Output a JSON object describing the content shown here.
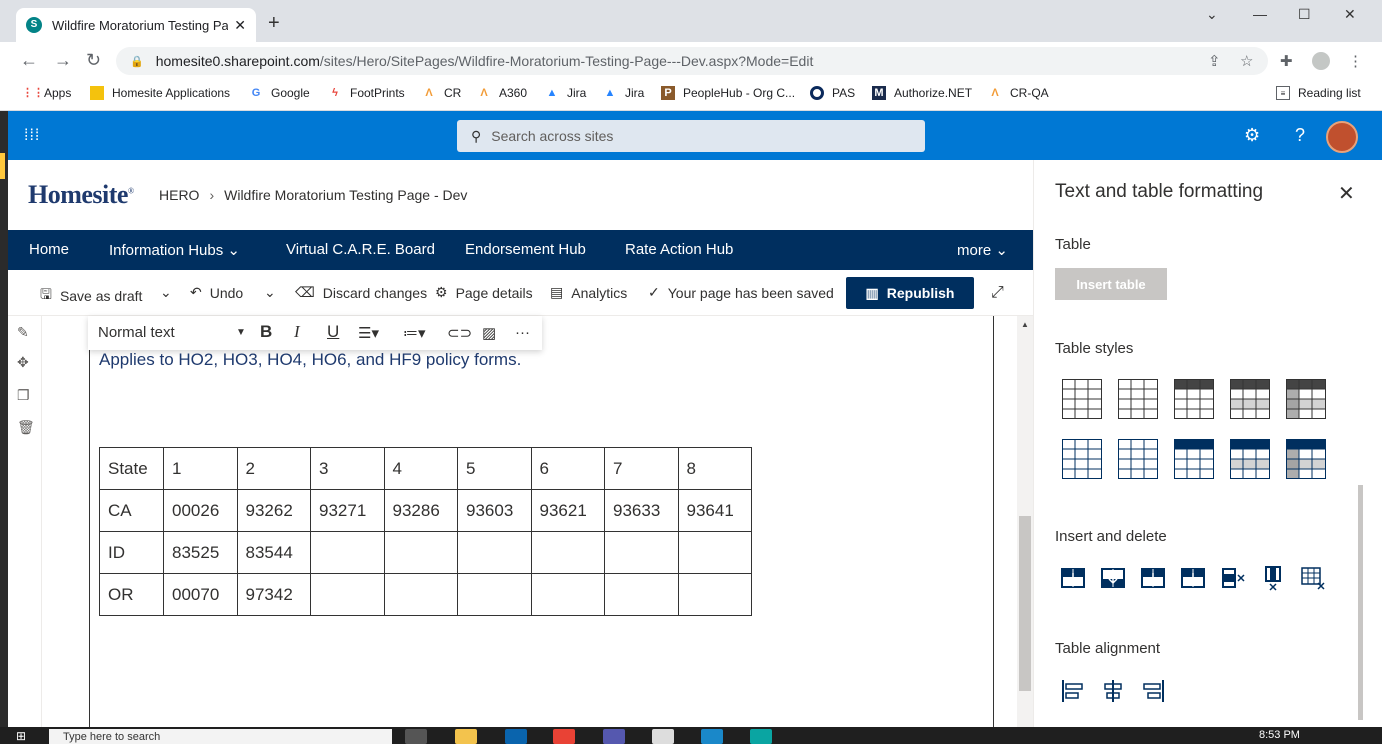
{
  "browser": {
    "tab_title": "Wildfire Moratorium Testing Page",
    "tab_favicon": "S",
    "url_host": "homesite0.sharepoint.com",
    "url_path": "/sites/Hero/SitePages/Wildfire-Moratorium-Testing-Page---Dev.aspx?Mode=Edit",
    "reading_list": "Reading list"
  },
  "bookmarks": [
    {
      "label": "Apps",
      "icon": "apps-grid-icon",
      "color": "#e8453c"
    },
    {
      "label": "Homesite Applications",
      "icon": "folder-icon",
      "color": "#f4c20d"
    },
    {
      "label": "Google",
      "icon": "google-icon",
      "color": "#4285f4"
    },
    {
      "label": "FootPrints",
      "icon": "footprints-icon",
      "color": "#e8453c"
    },
    {
      "label": "CR",
      "icon": "cr-icon",
      "color": "#f29c38"
    },
    {
      "label": "A360",
      "icon": "a360-icon",
      "color": "#f29c38"
    },
    {
      "label": "Jira",
      "icon": "jira-icon",
      "color": "#2684ff"
    },
    {
      "label": "Jira",
      "icon": "jira-icon",
      "color": "#2684ff"
    },
    {
      "label": "PeopleHub - Org C...",
      "icon": "peoplehub-icon",
      "color": "#8a5a2b"
    },
    {
      "label": "PAS",
      "icon": "pas-icon",
      "color": "#0b2a5c"
    },
    {
      "label": "Authorize.NET",
      "icon": "authorize-icon",
      "color": "#1a2b4c"
    },
    {
      "label": "CR-QA",
      "icon": "crqa-icon",
      "color": "#f29c38"
    }
  ],
  "suitebar": {
    "search_placeholder": "Search across sites",
    "color": "#0078d4"
  },
  "site": {
    "logo": "Homesite",
    "breadcrumb_root": "HERO",
    "breadcrumb_page": "Wildfire Moratorium Testing Page - Dev"
  },
  "hubnav": {
    "items": [
      "Home",
      "Information Hubs",
      "Virtual C.A.R.E. Board",
      "Endorsement Hub",
      "Rate Action Hub",
      "more"
    ],
    "color": "#002f5f"
  },
  "commands": {
    "save_draft": "Save as draft",
    "undo": "Undo",
    "discard": "Discard changes",
    "page_details": "Page details",
    "analytics": "Analytics",
    "saved_status": "Your page has been saved",
    "republish": "Republish"
  },
  "rte": {
    "style": "Normal text",
    "bold": "B",
    "italic": "I",
    "underline": "U"
  },
  "content": {
    "paragraph": "Applies to HO2, HO3, HO4, HO6, and HF9 policy forms.",
    "table": [
      [
        "State",
        "1",
        "2",
        "3",
        "4",
        "5",
        "6",
        "7",
        "8"
      ],
      [
        "CA",
        "00026",
        "93262",
        "93271",
        "93286",
        "93603",
        "93621",
        "93633",
        "93641"
      ],
      [
        "ID",
        "83525",
        "83544",
        "",
        "",
        "",
        "",
        "",
        ""
      ],
      [
        "OR",
        "00070",
        "97342",
        "",
        "",
        "",
        "",
        "",
        ""
      ]
    ]
  },
  "panel": {
    "title": "Text and table formatting",
    "section_table": "Table",
    "insert_table": "Insert table",
    "section_styles": "Table styles",
    "section_insert_delete": "Insert and delete",
    "section_alignment": "Table alignment",
    "style_dark": "#002f5f"
  },
  "taskbar": {
    "search_placeholder": "Type here to search",
    "clock": "8:53 PM"
  }
}
